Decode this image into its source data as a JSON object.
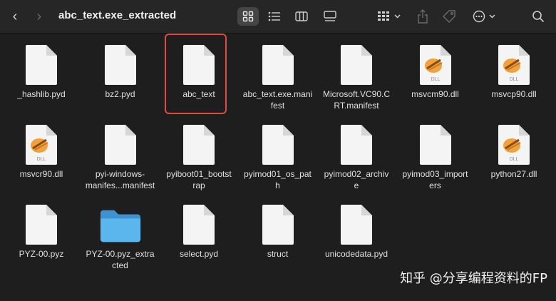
{
  "window": {
    "title": "abc_text.exe_extracted"
  },
  "toolbar": {
    "icons": [
      "chevron-left-icon",
      "chevron-right-icon",
      "icon-view-icon",
      "list-view-icon",
      "column-view-icon",
      "gallery-view-icon",
      "group-icon",
      "share-icon",
      "tag-icon",
      "more-icon",
      "search-icon"
    ]
  },
  "files": [
    {
      "name": "_hashlib.pyd",
      "kind": "doc"
    },
    {
      "name": "bz2.pyd",
      "kind": "doc"
    },
    {
      "name": "abc_text",
      "kind": "doc",
      "selected": true
    },
    {
      "name": "abc_text.exe.mani\nfest",
      "kind": "doc"
    },
    {
      "name": "Microsoft.VC90.C\nRT.manifest",
      "kind": "doc"
    },
    {
      "name": "msvcm90.dll",
      "kind": "dll"
    },
    {
      "name": "msvcp90.dll",
      "kind": "dll"
    },
    {
      "name": "msvcr90.dll",
      "kind": "dll"
    },
    {
      "name": "pyi-windows-\nmanifes...manifest",
      "kind": "doc"
    },
    {
      "name": "pyiboot01_bootst\nrap",
      "kind": "doc"
    },
    {
      "name": "pyimod01_os_pat\nh",
      "kind": "doc"
    },
    {
      "name": "pyimod02_archiv\ne",
      "kind": "doc"
    },
    {
      "name": "pyimod03_import\ners",
      "kind": "doc"
    },
    {
      "name": "python27.dll",
      "kind": "dll"
    },
    {
      "name": "PYZ-00.pyz",
      "kind": "doc"
    },
    {
      "name": "PYZ-00.pyz_extra\ncted",
      "kind": "folder"
    },
    {
      "name": "select.pyd",
      "kind": "doc"
    },
    {
      "name": "struct",
      "kind": "doc"
    },
    {
      "name": "unicodedata.pyd",
      "kind": "doc"
    }
  ],
  "dll_badge": "DLL",
  "watermark": "知乎 @分享编程资料的FP",
  "colors": {
    "selection": "#e04a3f",
    "folder": "#4aa8e6",
    "background": "#1e1e1e"
  }
}
